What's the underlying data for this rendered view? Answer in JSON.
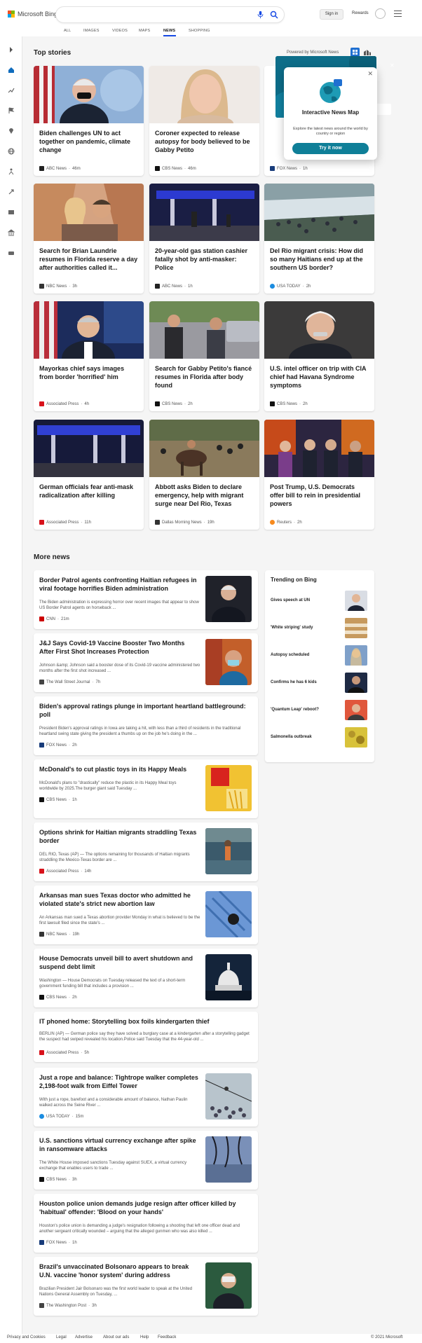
{
  "header": {
    "logo_text": "Microsoft Bing",
    "search_placeholder": "",
    "sign_in": "Sign in",
    "rewards": "Rewards"
  },
  "nav": [
    "ALL",
    "IMAGES",
    "VIDEOS",
    "MAPS",
    "NEWS",
    "SHOPPING"
  ],
  "top_stories": {
    "title": "Top stories",
    "powered": "Powered by Microsoft News",
    "cards": [
      {
        "title": "Biden challenges UN to act together on pandemic, climate change",
        "source": "ABC News",
        "time": "46m"
      },
      {
        "title": "Coroner expected to release autopsy for body believed to be Gabby Petito",
        "source": "CBS News",
        "time": "46m"
      },
      {
        "title": "",
        "source": "FOX News",
        "time": "1h"
      },
      {
        "title": "Search for Brian Laundrie resumes in Florida reserve a day after authorities called it...",
        "source": "NBC News",
        "time": "3h"
      },
      {
        "title": "20-year-old gas station cashier fatally shot by anti-masker: Police",
        "source": "ABC News",
        "time": "1h"
      },
      {
        "title": "Del Rio migrant crisis: How did so many Haitians end up at the southern US border?",
        "source": "USA TODAY",
        "time": "2h"
      },
      {
        "title": "Mayorkas chief says images from border 'horrified' him",
        "source": "Associated Press",
        "time": "4h"
      },
      {
        "title": "Search for Gabby Petito's fiancé resumes in Florida after body found",
        "source": "CBS News",
        "time": "2h"
      },
      {
        "title": "U.S. intel officer on trip with CIA chief had Havana Syndrome symptoms",
        "source": "CBS News",
        "time": "2h"
      },
      {
        "title": "German officials fear anti-mask radicalization after killing",
        "source": "Associated Press",
        "time": "11h"
      },
      {
        "title": "Abbott asks Biden to declare emergency, help with migrant surge near Del Rio, Texas",
        "source": "Dallas Morning News",
        "time": "19h"
      },
      {
        "title": "Post Trump, U.S. Democrats offer bill to rein in presidential powers",
        "source": "Reuters",
        "time": "2h"
      }
    ]
  },
  "popup": {
    "title": "Interactive News Map",
    "desc": "Explore the latest news around the world by country or region",
    "button": "Try it now"
  },
  "more_news": {
    "title": "More news",
    "items": [
      {
        "title": "Border Patrol agents confronting Haitian refugees in viral footage horrifies Biden administration",
        "snippet": "The Biden administration is expressing horror over recent images that appear to show US Border Patrol agents on horseback ...",
        "source": "CNN",
        "time": "21m"
      },
      {
        "title": "J&J Says Covid-19 Vaccine Booster Two Months After First Shot Increases Protection",
        "snippet": "Johnson &amp; Johnson said a booster dose of its Covid-19 vaccine administered two months after the first shot increased ...",
        "source": "The Wall Street Journal",
        "time": "7h"
      },
      {
        "title": "Biden's approval ratings plunge in important heartland battleground: poll",
        "snippet": "President Biden's approval ratings in Iowa are taking a hit, with less than a third of residents in the traditional heartland swing state giving the president a thumbs up on the job he's doing in the ...",
        "source": "FOX News",
        "time": "2h"
      },
      {
        "title": "McDonald's to cut plastic toys in its Happy Meals",
        "snippet": "McDonald's plans to \"drastically\" reduce the plastic in its Happy Meal toys worldwide by 2025.The burger giant said Tuesday ...",
        "source": "CBS News",
        "time": "1h"
      },
      {
        "title": "Options shrink for Haitian migrants straddling Texas border",
        "snippet": "DEL RIO, Texas (AP) — The options remaining for thousands of Haitian migrants straddling the Mexico-Texas border are ...",
        "source": "Associated Press",
        "time": "14h"
      },
      {
        "title": "Arkansas man sues Texas doctor who admitted he violated state's strict new abortion law",
        "snippet": "An Arkansas man sued a Texas abortion provider Monday in what is believed to be the first lawsuit filed since the state's ...",
        "source": "NBC News",
        "time": "19h"
      },
      {
        "title": "House Democrats unveil bill to avert shutdown and suspend debt limit",
        "snippet": "Washington — House Democrats on Tuesday released the text of a short-term government funding bill that includes a provision ...",
        "source": "CBS News",
        "time": "2h"
      },
      {
        "title": "IT phoned home: Storytelling box foils kindergarten thief",
        "snippet": "BERLIN (AP) — German police say they have solved a burglary case at a kindergarten after a storytelling gadget the suspect had swiped revealed his location.Police said Tuesday that the 44-year-old ...",
        "source": "Associated Press",
        "time": "5h"
      },
      {
        "title": "Just a rope and balance: Tightrope walker completes 2,198-foot walk from Eiffel Tower",
        "snippet": "With just a rope, barefoot and a considerable amount of balance, Nathan Paulin walked across the Seine River ...",
        "source": "USA TODAY",
        "time": "15m"
      },
      {
        "title": "U.S. sanctions virtual currency exchange after spike in ransomware attacks",
        "snippet": "The White House imposed sanctions Tuesday against SUEX, a virtual currency exchange that enables users to trade ...",
        "source": "CBS News",
        "time": "3h"
      },
      {
        "title": "Houston police union demands judge resign after officer killed by 'habitual' offender: 'Blood on your hands'",
        "snippet": "Houston's police union is demanding a judge's resignation following a shooting that left one officer dead and another sergeant critically wounded – arguing that the alleged gunmen who was also killed ...",
        "source": "FOX News",
        "time": "1h"
      },
      {
        "title": "Brazil's unvaccinated Bolsonaro appears to break U.N. vaccine 'honor system' during address",
        "snippet": "Brazilian President Jair Bolsonaro was the first world leader to speak at the United Nations General Assembly on Tuesday, ...",
        "source": "The Washington Post",
        "time": "3h"
      }
    ]
  },
  "trending": {
    "title": "Trending on Bing",
    "items": [
      "Gives speech at UN",
      "'White striping' study",
      "Autopsy scheduled",
      "Confirms he has 6 kids",
      "'Quantum Leap' reboot?",
      "Salmonella outbreak"
    ]
  },
  "footer": {
    "links": [
      "Privacy and Cookies",
      "Legal",
      "Advertise",
      "About our ads",
      "Help",
      "Feedback"
    ],
    "copyright": "© 2021 Microsoft"
  },
  "colors": {
    "accent": "#174ae4",
    "teal": "#0f7f98",
    "rail_active": "#0f6cbd"
  }
}
